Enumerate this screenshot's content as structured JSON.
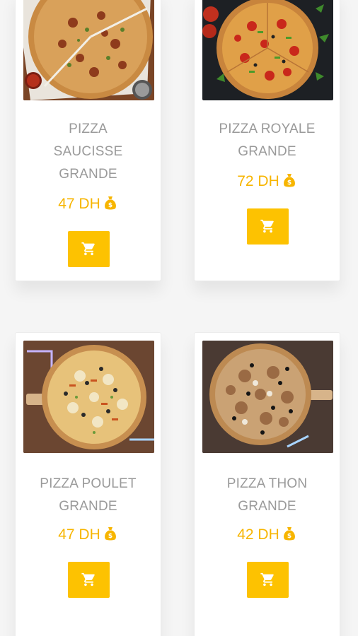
{
  "currency_icon": "money-bag-icon",
  "cart_icon": "shopping-cart-icon",
  "colors": {
    "price": "#f7b500",
    "button": "#fdc201",
    "name": "#9a9a9a",
    "background": "#f5f5f5"
  },
  "products": [
    {
      "name_lines": [
        "PIZZA",
        "SAUCISSE",
        "GRANDE"
      ],
      "price": "47 DH"
    },
    {
      "name_lines": [
        "PIZZA ROYALE",
        "GRANDE"
      ],
      "price": "72 DH"
    },
    {
      "name_lines": [
        "PIZZA POULET",
        "GRANDE"
      ],
      "price": "47 DH"
    },
    {
      "name_lines": [
        "PIZZA THON",
        "GRANDE"
      ],
      "price": "42 DH"
    }
  ]
}
